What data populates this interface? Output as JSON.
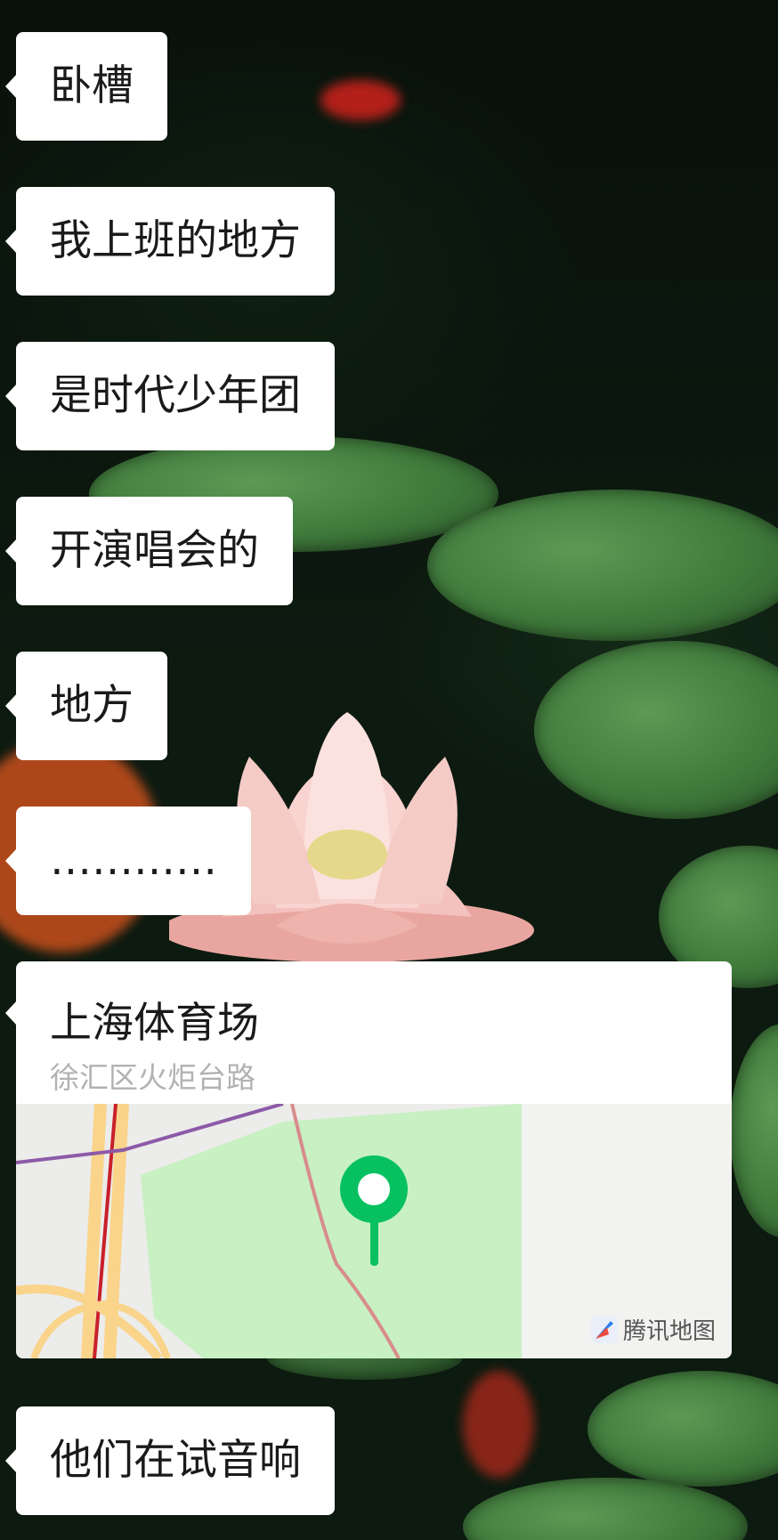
{
  "messages": [
    {
      "text": "卧槽"
    },
    {
      "text": "我上班的地方"
    },
    {
      "text": "是时代少年团"
    },
    {
      "text": "开演唱会的"
    },
    {
      "text": "地方"
    },
    {
      "text": "…………"
    },
    {
      "text": "他们在试音响"
    }
  ],
  "location": {
    "title": "上海体育场",
    "address": "徐汇区火炬台路",
    "map_brand": "腾讯地图"
  },
  "colors": {
    "bubble": "#ffffff",
    "pin": "#07c160",
    "map_park": "#c8f0c3",
    "map_bg": "#f2f2f0"
  }
}
